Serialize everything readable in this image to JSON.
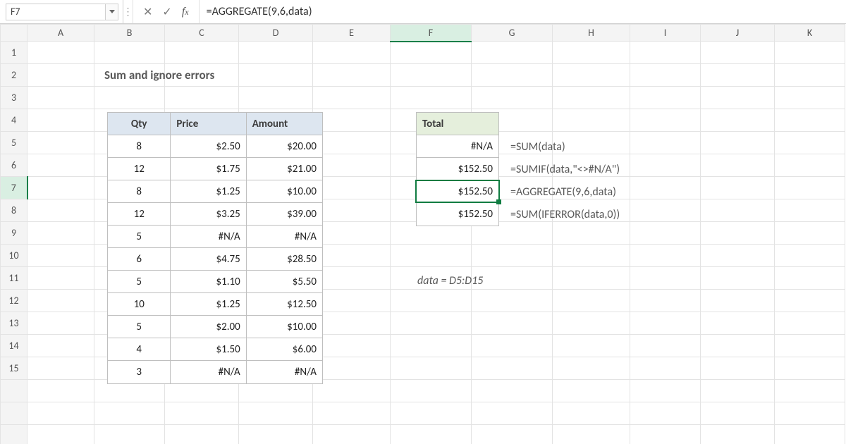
{
  "namebox": {
    "value": "F7"
  },
  "formula_bar": {
    "formula": "=AGGREGATE(9,6,data)"
  },
  "columns": [
    "A",
    "B",
    "C",
    "D",
    "E",
    "F",
    "G",
    "H",
    "I",
    "J",
    "K"
  ],
  "rows": [
    "1",
    "2",
    "3",
    "4",
    "5",
    "6",
    "7",
    "8",
    "9",
    "10",
    "11",
    "12",
    "13",
    "14",
    "15"
  ],
  "title": "Sum and ignore errors",
  "table_main": {
    "headers": {
      "qty": "Qty",
      "price": "Price",
      "amount": "Amount"
    },
    "rows": [
      {
        "qty": "8",
        "price": "$2.50",
        "amount": "$20.00"
      },
      {
        "qty": "12",
        "price": "$1.75",
        "amount": "$21.00"
      },
      {
        "qty": "8",
        "price": "$1.25",
        "amount": "$10.00"
      },
      {
        "qty": "12",
        "price": "$3.25",
        "amount": "$39.00"
      },
      {
        "qty": "5",
        "price": "#N/A",
        "amount": "#N/A"
      },
      {
        "qty": "6",
        "price": "$4.75",
        "amount": "$28.50"
      },
      {
        "qty": "5",
        "price": "$1.10",
        "amount": "$5.50"
      },
      {
        "qty": "10",
        "price": "$1.25",
        "amount": "$12.50"
      },
      {
        "qty": "5",
        "price": "$2.00",
        "amount": "$10.00"
      },
      {
        "qty": "4",
        "price": "$1.50",
        "amount": "$6.00"
      },
      {
        "qty": "3",
        "price": "#N/A",
        "amount": "#N/A"
      }
    ]
  },
  "totals": {
    "header": "Total",
    "values": [
      "#N/A",
      "$152.50",
      "$152.50",
      "$152.50"
    ],
    "formulas": [
      "=SUM(data)",
      "=SUMIF(data,\"<>#N/A\")",
      "=AGGREGATE(9,6,data)",
      "=SUM(IFERROR(data,0))"
    ]
  },
  "range_note": "data = D5:D15"
}
